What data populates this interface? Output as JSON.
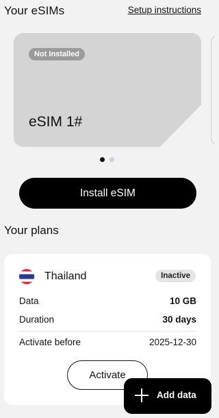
{
  "header": {
    "title": "Your eSIMs",
    "setup_link": "Setup instructions"
  },
  "esim": {
    "status": "Not Installed",
    "name": "eSIM 1#"
  },
  "carousel": {
    "page_count": 2,
    "active_index": 0
  },
  "install_button": "Install eSIM",
  "plans": {
    "title": "Your plans",
    "items": [
      {
        "country": "Thailand",
        "flag_icon": "thailand-flag-icon",
        "status": "Inactive",
        "data_label": "Data",
        "data_value": "10 GB",
        "duration_label": "Duration",
        "duration_value": "30 days",
        "activate_before_label": "Activate before",
        "activate_before_value": "2025-12-30",
        "activate_button": "Activate"
      }
    ]
  },
  "fab": {
    "label": "Add data",
    "icon": "plus-icon"
  },
  "colors": {
    "background": "#f2f2f2",
    "card": "#d4d4d4",
    "primary": "#000000",
    "dot_active": "#111111",
    "dot_inactive": "#c5d3e6"
  }
}
